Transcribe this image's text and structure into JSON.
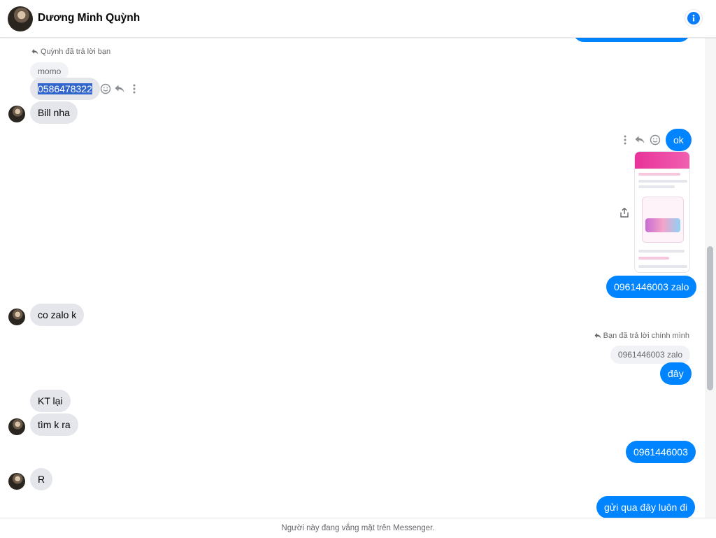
{
  "header": {
    "contact_name": "Dương Minh Quỳnh",
    "avatar_icon": "profile-photo",
    "info_icon": "info-icon"
  },
  "messages": {
    "reply_note_1": "Quỳnh đã trả lời bạn",
    "quoted_1": "momo",
    "m_phone_selected": "0586478322",
    "m_bill": "Bill nha",
    "m_ok": "ok",
    "m_zalo_number": "0961446003 zalo",
    "m_co_zalo": "co zalo k",
    "reply_note_2": "Bạn đã trả lời chính mình",
    "quoted_2": "0961446003 zalo",
    "m_day": "đây",
    "m_kt_lai": "KT lại",
    "m_tim_k_ra": "tìm k ra",
    "m_number": "0961446003",
    "m_r": "R",
    "m_gui_qua": "gửi qua đây luôn đi"
  },
  "footer": {
    "status_text": "Người này đang vắng mặt trên Messenger."
  },
  "colors": {
    "accent": "#0084ff",
    "incoming_bubble": "#e4e6eb",
    "selection": "#3366cc"
  }
}
